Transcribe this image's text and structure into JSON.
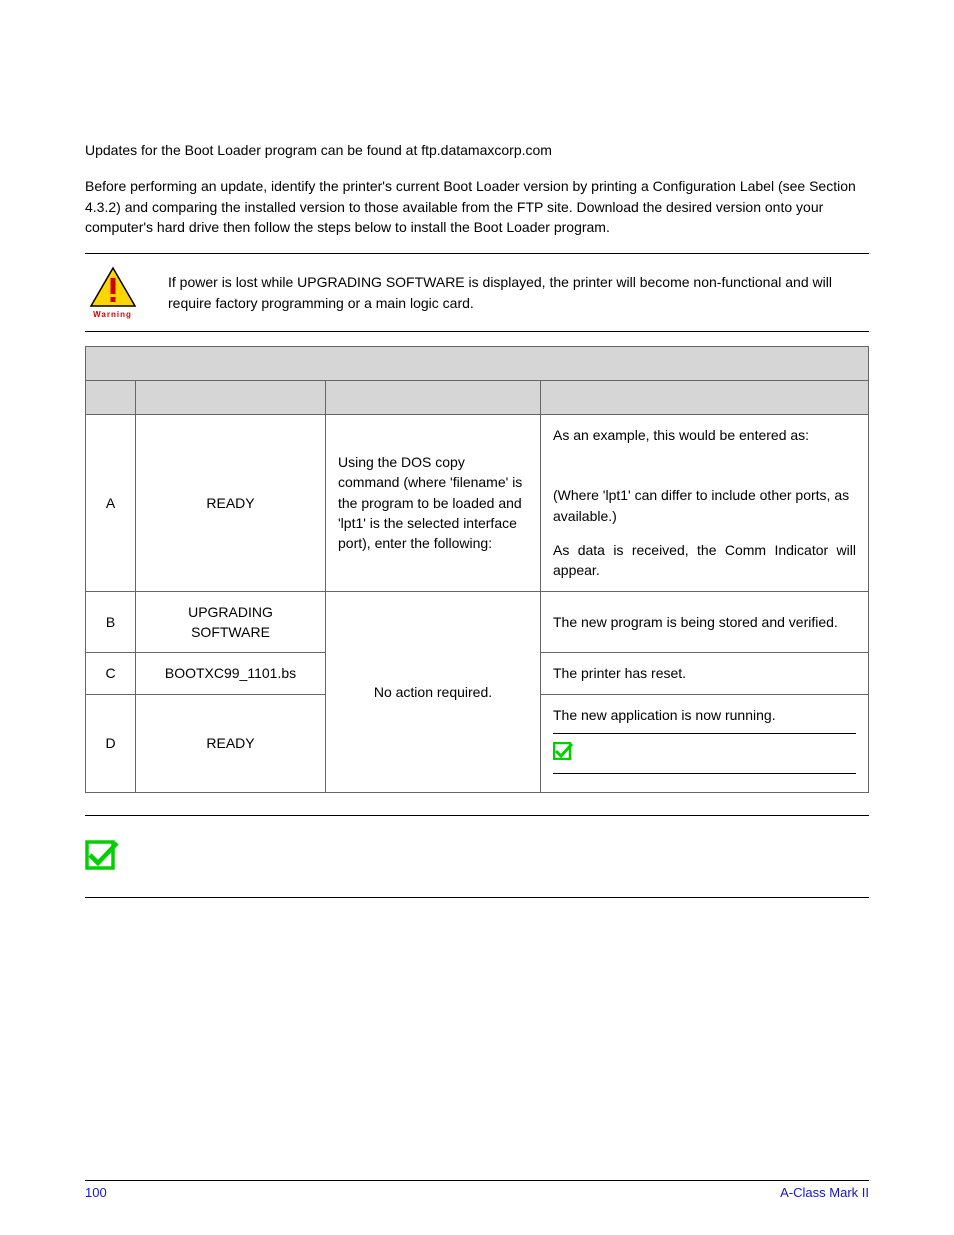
{
  "intro": {
    "p1": "Updates for the Boot Loader program can be found at ftp.datamaxcorp.com",
    "p2": "Before performing an update, identify the printer's current Boot Loader version by printing a Configuration Label (see Section 4.3.2) and comparing the installed version to those available from the FTP site. Download the desired version onto your computer's hard drive then follow the steps below to install the Boot Loader program."
  },
  "warning": {
    "label": "Warning",
    "text": "If power is lost while UPGRADING SOFTWARE is displayed, the printer will become non-functional and will require factory programming or a main logic card."
  },
  "table": {
    "rows": {
      "a": {
        "step": "A",
        "display": "READY",
        "action": "Using the DOS copy command (where 'filename' is the program to be loaded  and 'lpt1' is the selected interface port), enter the following:",
        "comment_l1": "As an example, this would be entered as:",
        "comment_l2": "(Where 'lpt1' can differ to include other ports, as available.)",
        "comment_l3": "As data is received, the Comm Indicator will appear."
      },
      "b": {
        "step": "B",
        "display": "UPGRADING SOFTWARE",
        "comment": "The new program is being stored and verified."
      },
      "c": {
        "step": "C",
        "display": "BOOTXC99_1101.bs",
        "comment": "The printer has reset."
      },
      "bc_action": "No action required.",
      "d": {
        "step": "D",
        "display": "READY",
        "comment": "The new application is now running."
      }
    }
  },
  "footer": {
    "page": "100",
    "doc": "A-Class Mark II"
  }
}
